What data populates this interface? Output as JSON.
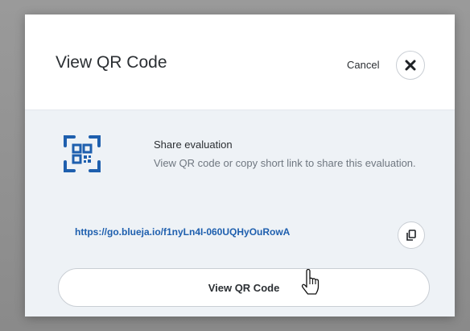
{
  "modal": {
    "title": "View QR Code",
    "cancel_label": "Cancel",
    "close_icon": "close-icon"
  },
  "share": {
    "icon": "qr-code-icon",
    "title": "Share evaluation",
    "description": "View QR code or copy short link to share this evaluation.",
    "short_link": "https://go.blueja.io/f1nyLn4I-060UQHyOuRowA",
    "copy_icon": "copy-icon"
  },
  "actions": {
    "view_qr_label": "View QR Code"
  },
  "colors": {
    "accent": "#1e5fae",
    "body_bg": "#eef2f6",
    "text": "#2b2f33",
    "muted": "#6f7780"
  }
}
